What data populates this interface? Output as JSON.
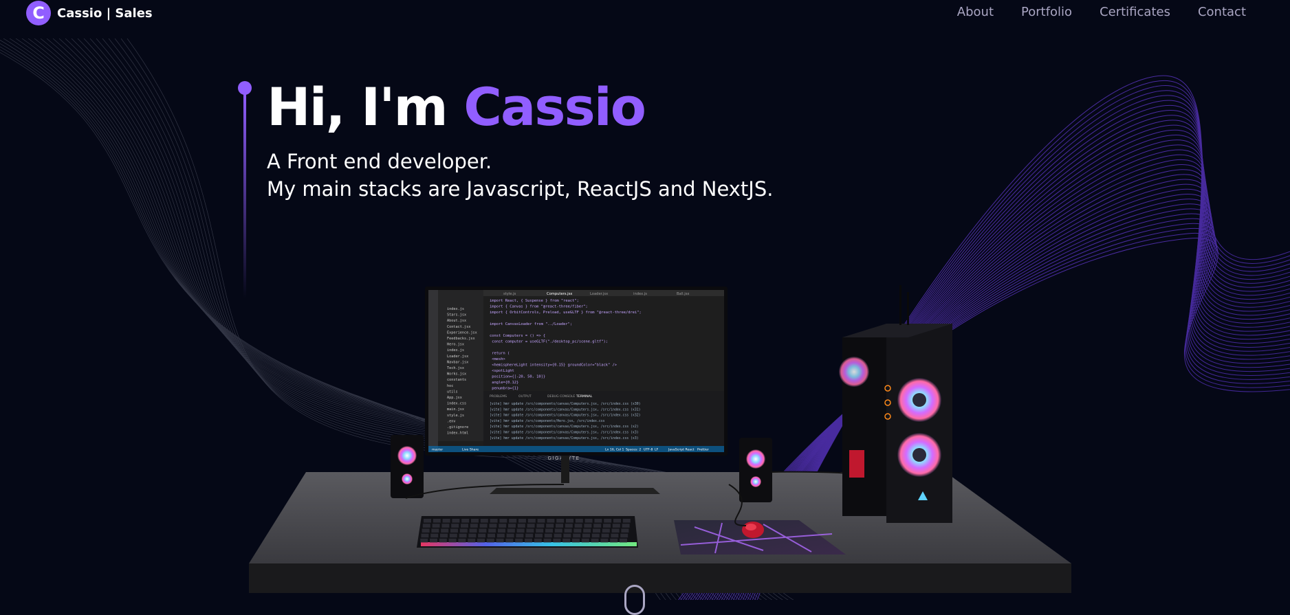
{
  "brand": {
    "logo_letter": "C",
    "name": "Cassio | Sales",
    "accent_color": "#915eff",
    "background_color": "#050816"
  },
  "nav": {
    "links": [
      "About",
      "Portfolio",
      "Certificates",
      "Contact"
    ]
  },
  "hero": {
    "greeting": "Hi, I'm ",
    "name": "Cassio",
    "line1": "A Front end developer.",
    "line2": "My main stacks are Javascript, ReactJS and NextJS."
  },
  "scene": {
    "monitor_brand": "GIGABYTE",
    "editor_tabs": [
      "style.js",
      "Computers.jsx",
      "Loader.jsx",
      "index.js",
      "Ball.jsx"
    ],
    "explorer_files": [
      "index.js",
      "Stars.jsx",
      "About.jsx",
      "Contact.jsx",
      "Experience.jsx",
      "Feedbacks.jsx",
      "Hero.jsx",
      "index.js",
      "Loader.jsx",
      "Navbar.jsx",
      "Tech.jsx",
      "Works.jsx",
      "constants",
      "hoc",
      "utils",
      "App.jsx",
      "index.css",
      "main.jsx",
      "style.js",
      ".env",
      ".gitignore",
      "index.html"
    ],
    "code_lines": [
      "import React, { Suspense } from \"react\";",
      "import { Canvas } from \"@react-three/fiber\";",
      "import { OrbitControls, Preload, useGLTF } from \"@react-three/drei\";",
      "",
      "import CanvasLoader from \"../Loader\";",
      "",
      "const Computers = () => {",
      "  const computer = useGLTF(\"./desktop_pc/scene.gltf\");",
      "",
      "  return (",
      "    <mesh>",
      "      <hemisphereLight intensity={0.15} groundColor=\"black\" />",
      "      <spotLight",
      "        position={[-20, 50, 10]}",
      "        angle={0.12}",
      "        penumbra={1}"
    ],
    "panel_tabs": [
      "PROBLEMS",
      "OUTPUT",
      "DEBUG CONSOLE",
      "TERMINAL"
    ],
    "terminal_lines": [
      "[vite] hmr update /src/components/canvas/Computers.jsx, /src/index.css (x30)",
      "[vite] hmr update /src/components/canvas/Computers.jsx, /src/index.css (x31)",
      "[vite] hmr update /src/components/canvas/Computers.jsx, /src/index.css (x32)",
      "[vite] hmr update /src/components/Hero.jsx, /src/index.css",
      "[vite] hmr update /src/components/canvas/Computers.jsx, /src/index.css (x2)",
      "[vite] hmr update /src/components/canvas/Computers.jsx, /src/index.css (x3)",
      "[vite] hmr update /src/components/canvas/Computers.jsx, /src/index.css (x3)"
    ],
    "status_bar": [
      "master",
      "Live Share",
      "Ln 16, Col 1",
      "Spaces: 2",
      "UTF-8",
      "LF",
      "JavaScript React",
      "Prettier"
    ]
  },
  "icons": {
    "scroll_indicator": "scroll-down-icon"
  }
}
